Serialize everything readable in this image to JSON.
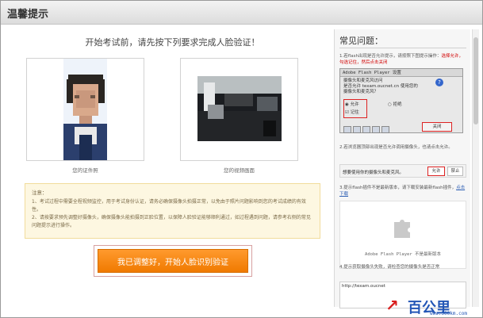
{
  "dialog": {
    "title": "温馨提示"
  },
  "main": {
    "instruction": "开始考试前，请先按下列要求完成人脸验证！",
    "id_photo_caption": "您的证件照",
    "camera_caption": "您的视频画面",
    "notice": {
      "heading": "注意：",
      "items": [
        "1、考试过程中需要全程视频监控，用于考试身份认证，请务必确保摄像头拍摄正常，以免由于照片问题影响到您的考试成绩的有效性。",
        "2、请按要求预先调整好摄像头，确保摄像头能拍摄到正脸位置，以保障人脸验证能够顺利通过，如过程遇到问题，请参考右侧的常见问题提示进行操作。"
      ]
    },
    "start_button": "我已调整好，开始人脸识别验证"
  },
  "faq": {
    "title": "常见问题：",
    "q1_pre": "1.若flash出现是否允许提示，请按照下图提示操作：",
    "q1_red": "选择允许，勾选记住，然后点击关闭",
    "flash_dialog": {
      "title": "Adobe Flash Player 设置",
      "text_lines": [
        "摄像头和麦克风访问",
        "是否允许 texam.oucnet.cn 使用您的",
        "摄像头和麦克风？"
      ],
      "allow": "允许",
      "deny": "拒绝",
      "remember": "记住",
      "close": "关闭"
    },
    "q2": "2.若浏览器顶部出现是否允许调用摄像头，也请点击允许。",
    "cam_prompt": {
      "message": "想要使用你的摄像头和麦克风。",
      "allow": "允许",
      "block": "禁止"
    },
    "q3_pre": "3.提示flash插件不是最新版本，请下载安装最新flash插件，",
    "q3_link": "点击下载",
    "flash_missing": "Adobe Flash Player 不是最新版本",
    "q4": "4.提示获取摄像头失败，请检查您的摄像头是否正常",
    "browser_url": "http://texam.oucnet"
  },
  "watermark": {
    "brand": "百公里",
    "url": "www.500km.com"
  },
  "colors": {
    "accent": "#f07a00",
    "warn_red": "#d10000",
    "link": "#2d5fb4"
  }
}
